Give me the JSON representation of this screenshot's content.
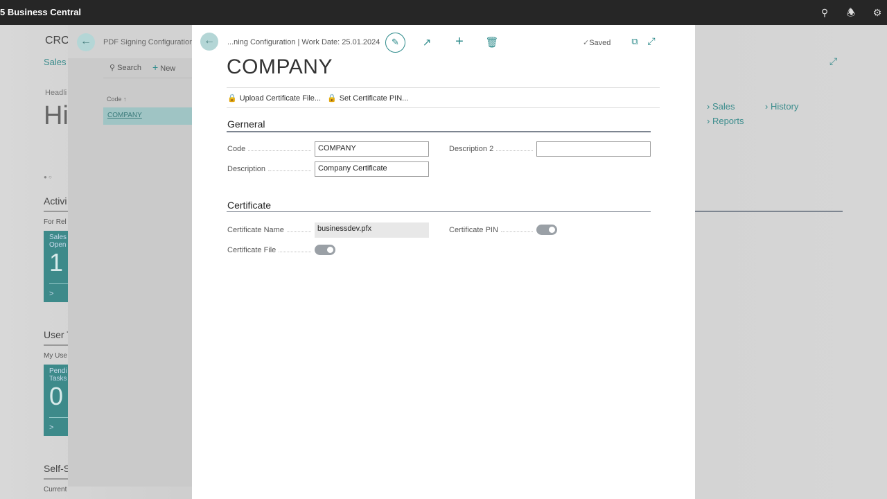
{
  "app": {
    "title": "5 Business Central",
    "icons": [
      "search-icon",
      "bell-icon",
      "gear-icon"
    ]
  },
  "role_center": {
    "company": "CROI",
    "sales_link": "Sales C",
    "headline_label": "Headli",
    "headline": "Hi",
    "links": [
      "Sales",
      "History",
      "Reports"
    ],
    "activities": {
      "title": "Activi",
      "subtitle": "For Rel",
      "tile_label": "Sales Open",
      "tile_value": "1"
    },
    "user_tasks": {
      "title": "User T",
      "subtitle": "My Use",
      "tile_label": "Pendi Tasks",
      "tile_value": "0"
    },
    "self_service": {
      "title": "Self-S",
      "subtitle": "Current"
    }
  },
  "list": {
    "title": "PDF Signing Configurations",
    "search": "Search",
    "new": "New",
    "column": "Code",
    "sort_indicator": "↑",
    "rows": [
      "COMPANY"
    ]
  },
  "card": {
    "caption": "...ning Configuration | Work Date: 25.01.2024",
    "status": "Saved",
    "title": "COMPANY",
    "actions": [
      "Upload Certificate File...",
      "Set Certificate PIN..."
    ],
    "general": {
      "title": "Gerneral",
      "code_label": "Code",
      "code_value": "COMPANY",
      "description_label": "Description",
      "description_value": "Company Certificate",
      "description2_label": "Description 2",
      "description2_value": ""
    },
    "certificate": {
      "title": "Certificate",
      "name_label": "Certificate Name",
      "name_value": "businessdev.pfx",
      "pin_label": "Certificate PIN",
      "pin_on": true,
      "file_label": "Certificate File",
      "file_on": true
    }
  },
  "colors": {
    "accent": "#2d8b8b",
    "topbar": "#262626"
  }
}
